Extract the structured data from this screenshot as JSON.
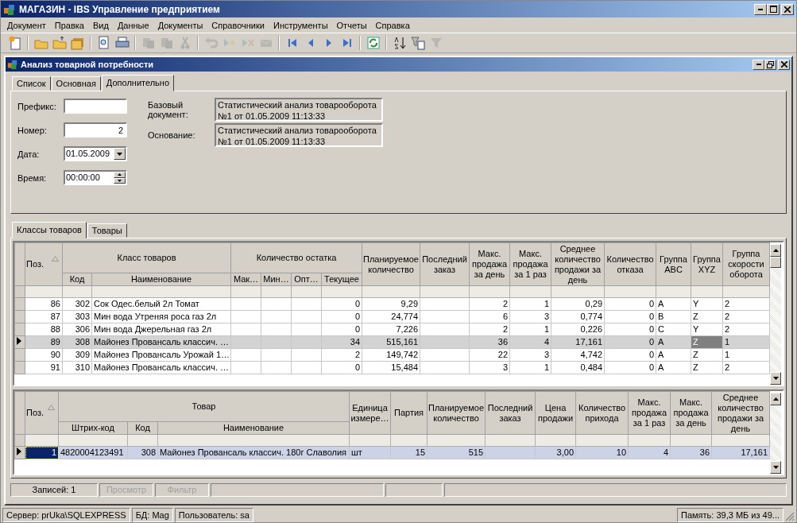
{
  "window": {
    "title": "МАГАЗИН - IBS Управление предприятием"
  },
  "menu": [
    "Документ",
    "Правка",
    "Вид",
    "Данные",
    "Документы",
    "Справочники",
    "Инструменты",
    "Отчеты",
    "Справка"
  ],
  "toolbar": [
    {
      "kind": "new",
      "disabled": false
    },
    {
      "kind": "sep"
    },
    {
      "kind": "open",
      "disabled": false
    },
    {
      "kind": "folder-up",
      "disabled": false
    },
    {
      "kind": "folders",
      "disabled": false
    },
    {
      "kind": "sep"
    },
    {
      "kind": "preview",
      "disabled": false
    },
    {
      "kind": "print",
      "disabled": false
    },
    {
      "kind": "sep"
    },
    {
      "kind": "copy",
      "disabled": true
    },
    {
      "kind": "paste",
      "disabled": true
    },
    {
      "kind": "cut",
      "disabled": true
    },
    {
      "kind": "sep"
    },
    {
      "kind": "undo",
      "disabled": true
    },
    {
      "kind": "insert",
      "disabled": true
    },
    {
      "kind": "delete",
      "disabled": true
    },
    {
      "kind": "post",
      "disabled": true
    },
    {
      "kind": "sep"
    },
    {
      "kind": "first",
      "disabled": false
    },
    {
      "kind": "prev",
      "disabled": false
    },
    {
      "kind": "next",
      "disabled": false
    },
    {
      "kind": "last",
      "disabled": false
    },
    {
      "kind": "sep"
    },
    {
      "kind": "refresh",
      "disabled": false
    },
    {
      "kind": "sep"
    },
    {
      "kind": "sort",
      "disabled": false
    },
    {
      "kind": "filter-edit",
      "disabled": false
    },
    {
      "kind": "filter",
      "disabled": true
    }
  ],
  "document": {
    "title": "Анализ товарной потребности",
    "tabs": [
      {
        "label": "Список",
        "selected": false
      },
      {
        "label": "Основная",
        "selected": false
      },
      {
        "label": "Дополнительно",
        "selected": true
      }
    ],
    "fields": [
      {
        "label": "Префикс:",
        "kind": "text"
      },
      {
        "label": "Номер:",
        "kind": "number",
        "value": "2"
      },
      {
        "label": "Дата:",
        "kind": "date",
        "value": "01.05.2009"
      },
      {
        "label": "Время:",
        "kind": "time",
        "value": "00:00:00"
      }
    ],
    "references": [
      {
        "label": "Базовый документ:",
        "value": "Статистический анализ товарооборота\n№1 от 01.05.2009 11:13:33"
      },
      {
        "label": "Основание:",
        "value": "Статистический анализ товарооборота\n№1 от 01.05.2009 11:13:33"
      }
    ],
    "grid_tabs": [
      {
        "label": "Классы товаров",
        "selected": true
      },
      {
        "label": "Товары",
        "selected": false
      }
    ],
    "classes_table": {
      "active": false,
      "columns": [
        {
          "label": "Поз.",
          "sorted": true
        },
        {
          "label": "Класс товаров",
          "colspan": 2,
          "children": [
            {
              "label": "Код"
            },
            {
              "label": "Наименование"
            }
          ]
        },
        {
          "label": "Количество остатка",
          "colspan": 4,
          "children": [
            {
              "label": "Мак…"
            },
            {
              "label": "Мин…"
            },
            {
              "label": "Опт…"
            },
            {
              "label": "Текущее"
            }
          ]
        },
        {
          "label": "Планируемое количество"
        },
        {
          "label": "Последний заказ"
        },
        {
          "label": "Макс. продажа за день"
        },
        {
          "label": "Макс. продажа за 1 раз"
        },
        {
          "label": "Среднее количество продажи за день"
        },
        {
          "label": "Количество отказа"
        },
        {
          "label": "Группа ABC"
        },
        {
          "label": "Группа XYZ"
        },
        {
          "label": "Группа скорости оборота"
        }
      ],
      "rows": [
        {
          "selected": false,
          "cells": [
            "86",
            "302",
            "Сок Одес.белый 2л Томат",
            null,
            null,
            null,
            "0",
            "9,29",
            null,
            "2",
            "1",
            "0,29",
            "0",
            "A",
            "Y",
            "2"
          ]
        },
        {
          "selected": false,
          "cells": [
            "87",
            "303",
            "Мин вода Утреняя роса газ 2л",
            null,
            null,
            null,
            "0",
            "24,774",
            null,
            "6",
            "3",
            "0,774",
            "0",
            "B",
            "Z",
            "2"
          ]
        },
        {
          "selected": false,
          "cells": [
            "88",
            "306",
            "Мин вода Джерельная газ 2л",
            null,
            null,
            null,
            "0",
            "7,226",
            null,
            "2",
            "1",
            "0,226",
            "0",
            "C",
            "Y",
            "2"
          ]
        },
        {
          "selected": true,
          "cells": [
            "89",
            "308",
            "Майонез Провансаль классич. …",
            null,
            null,
            null,
            "34",
            "515,161",
            null,
            "36",
            "4",
            "17,161",
            "0",
            "A",
            {
              "text": "Z",
              "focused": true
            },
            "1"
          ]
        },
        {
          "selected": false,
          "cells": [
            "90",
            "309",
            "Майонез Провансаль Урожай 1…",
            null,
            null,
            null,
            "2",
            "149,742",
            null,
            "22",
            "3",
            "4,742",
            "0",
            "A",
            "Z",
            "1"
          ]
        },
        {
          "selected": false,
          "cells": [
            "91",
            "310",
            "Майонез Провансаль классич. …",
            null,
            null,
            null,
            "0",
            "15,484",
            null,
            "3",
            "1",
            "0,484",
            "0",
            "A",
            "Z",
            "2"
          ]
        }
      ]
    },
    "items_table": {
      "active": true,
      "columns": [
        {
          "label": "Поз.",
          "sorted": true
        },
        {
          "label": "Товар",
          "colspan": 3,
          "children": [
            {
              "label": "Штрих-код"
            },
            {
              "label": "Код"
            },
            {
              "label": "Наименование"
            }
          ]
        },
        {
          "label": "Единица измере…"
        },
        {
          "label": "Партия"
        },
        {
          "label": "Планируемое количество"
        },
        {
          "label": "Последний заказ"
        },
        {
          "label": "Цена продажи"
        },
        {
          "label": "Количество прихода"
        },
        {
          "label": "Макс. продажа за 1 раз"
        },
        {
          "label": "Макс. продажа за день"
        },
        {
          "label": "Среднее количество продажи за день"
        }
      ],
      "rows": [
        {
          "selected": true,
          "cells": [
            {
              "text": "1",
              "focused": true
            },
            "4820004123491",
            "308",
            "Майонез Провансаль классич. 180г Славолия",
            "шт",
            "15",
            "515",
            null,
            "3,00",
            "10",
            "4",
            "36",
            "17,161"
          ]
        }
      ]
    },
    "status": [
      {
        "text": "Записей: 1",
        "disabled": false
      },
      {
        "text": "Просмотр",
        "disabled": true
      },
      {
        "text": "Фильтр",
        "disabled": true
      }
    ]
  },
  "status_bar": [
    "Сервер: prUka\\SQLEXPRESS",
    "БД: Mag",
    "Пользователь: sa",
    "Память: 39,3 МБ из 49..."
  ]
}
